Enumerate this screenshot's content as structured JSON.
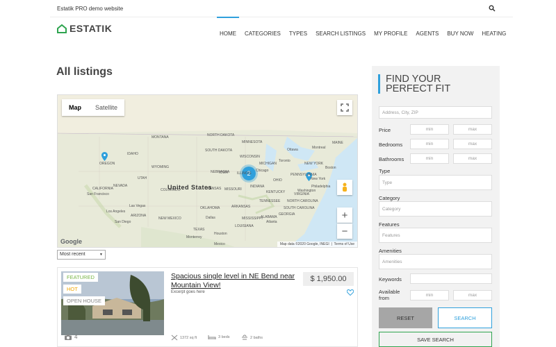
{
  "topbar": {
    "site_name": "Estatik PRO demo website"
  },
  "logo": {
    "text": "ESTATIK"
  },
  "nav": {
    "items": [
      "HOME",
      "CATEGORIES",
      "TYPES",
      "SEARCH LISTINGS",
      "MY PROFILE",
      "AGENTS",
      "BUY NOW",
      "HEATING"
    ],
    "active": "HOME"
  },
  "page": {
    "title": "All listings"
  },
  "map": {
    "type_buttons": [
      "Map",
      "Satellite"
    ],
    "selected_type": "Map",
    "cluster_count": "2",
    "country_label": "United States",
    "google_logo": "Google",
    "attribution": "Map data ©2020 Google, INEGI",
    "terms": "Terms of Use",
    "zoom_in": "+",
    "zoom_out": "−",
    "labels": [
      "NORTH DAKOTA",
      "MONTANA",
      "MINNESOTA",
      "SOUTH DAKOTA",
      "WYOMING",
      "IDAHO",
      "OREGON",
      "NEBRASKA",
      "IOWA",
      "NEVADA",
      "UTAH",
      "COLORADO",
      "KANSAS",
      "ILLINOIS",
      "INDIANA",
      "OHIO",
      "MISSOURI",
      "KENTUCKY",
      "VIRGINIA",
      "OKLAHOMA",
      "ARKANSAS",
      "TENNESSEE",
      "NEW MEXICO",
      "ARIZONA",
      "TEXAS",
      "LOUISIANA",
      "MISSISSIPPI",
      "ALABAMA",
      "GEORGIA",
      "NORTH CAROLINA",
      "SOUTH CAROLINA",
      "WISCONSIN",
      "MICHIGAN",
      "PENNSYLVANIA",
      "NEW YORK",
      "MAINE",
      "CALIFORNIA",
      "San Francisco",
      "Las Vegas",
      "Los Angeles",
      "San Diego",
      "Dallas",
      "Houston",
      "Chicago",
      "Toronto",
      "Ottawa",
      "Montreal",
      "Philadelphia",
      "Boston",
      "New York",
      "Washington",
      "Atlanta",
      "Monterrey",
      "Mexico"
    ]
  },
  "sort": {
    "selected": "Most recent"
  },
  "listing": {
    "badges": [
      "FEATURED",
      "HOT",
      "OPEN HOUSE"
    ],
    "badge_colors": [
      "#7ab648",
      "#f0a500",
      "#888888"
    ],
    "photo_count": "4",
    "title": "Spacious single level in NE Bend near Mountain View!",
    "excerpt": "Excerpt goes here",
    "price": "$ 1,950.00",
    "area": "1372 sq ft",
    "beds": "3 beds",
    "baths": "2 baths"
  },
  "search": {
    "heading": "FIND YOUR PERFECT FIT",
    "address_placeholder": "Address, City, ZIP",
    "price_label": "Price",
    "bedrooms_label": "Bedrooms",
    "bathrooms_label": "Bathrooms",
    "min": "min",
    "max": "max",
    "type_label": "Type",
    "type_placeholder": "Type",
    "category_label": "Category",
    "category_placeholder": "Category",
    "features_label": "Features",
    "features_placeholder": "Features",
    "amenities_label": "Amenities",
    "amenities_placeholder": "Amenities",
    "keywords_label": "Keywords",
    "available_from_label": "Available from",
    "reset": "RESET",
    "search": "SEARCH",
    "save_search": "SAVE SEARCH"
  },
  "colors": {
    "accent": "#2fa0dc",
    "green": "#2ea44f",
    "button_gray": "#a6a6a6"
  }
}
